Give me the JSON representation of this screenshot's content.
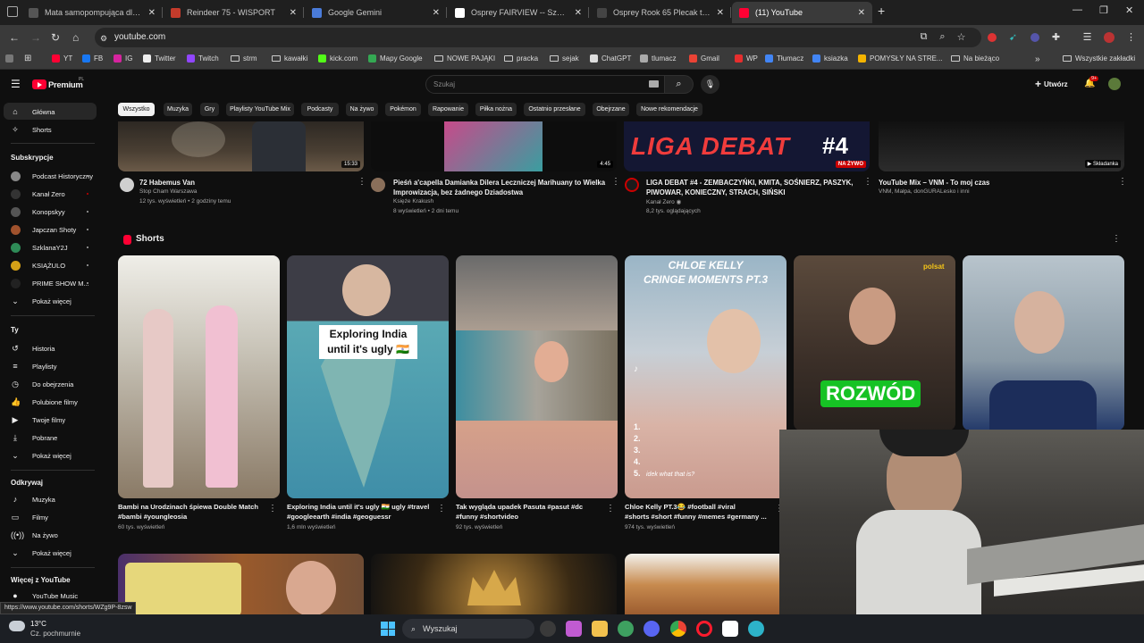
{
  "browser": {
    "tabs": [
      {
        "label": "Mata samopompująca dla back",
        "favicon_color": "#555555",
        "active": false
      },
      {
        "label": "Reindeer 75 - WISPORT",
        "favicon_color": "#c43b2b",
        "active": false
      },
      {
        "label": "Google Gemini",
        "favicon_color": "#4a7bd9",
        "active": false
      },
      {
        "label": "Osprey FAIRVIEW -- Szukaj w G",
        "favicon_color": "#ffffff",
        "active": false
      },
      {
        "label": "Osprey Rook 65 Plecak trekking",
        "favicon_color": "#444444",
        "active": false
      },
      {
        "label": "(11) YouTube",
        "favicon_color": "#ff0033",
        "active": true
      }
    ],
    "url": "youtube.com",
    "bookmarks": [
      {
        "label": "YT",
        "color": "#ff0033"
      },
      {
        "label": "FB",
        "color": "#1877f2"
      },
      {
        "label": "IG",
        "color": "#d6249f"
      },
      {
        "label": "Twitter",
        "color": "#eeeeee"
      },
      {
        "label": "Twitch",
        "color": "#9146ff"
      },
      {
        "label": "strm",
        "color": ""
      },
      {
        "label": "kawałki",
        "color": ""
      },
      {
        "label": "kick.com",
        "color": "#53fc18"
      },
      {
        "label": "Mapy Google",
        "color": "#34a853"
      },
      {
        "label": "NOWE PAJĄKI",
        "color": ""
      },
      {
        "label": "pracka",
        "color": ""
      },
      {
        "label": "sejak",
        "color": ""
      },
      {
        "label": "ChatGPT",
        "color": "#dddddd"
      },
      {
        "label": "tlumacz",
        "color": "#aaaaaa"
      },
      {
        "label": "Gmail",
        "color": "#ea4335"
      },
      {
        "label": "WP",
        "color": "#e62e2e"
      },
      {
        "label": "Tłumacz",
        "color": "#4285f4"
      },
      {
        "label": "ksiazka",
        "color": "#4285f4"
      },
      {
        "label": "POMYSŁY NA STRE...",
        "color": "#f4b400"
      },
      {
        "label": "Na bieżąco",
        "color": ""
      }
    ],
    "all_bookmarks": "Wszystkie zakładki",
    "status_url": "https://www.youtube.com/shorts/WZg9P-8zsw"
  },
  "youtube": {
    "logo_text": "Premium",
    "logo_super": "PL",
    "search_placeholder": "Szukaj",
    "create_label": "Utwórz",
    "notif_count": "9+",
    "chips": [
      "Wszystko",
      "Muzyka",
      "Gry",
      "Playlisty YouTube Mix",
      "Podcasty",
      "Na żywo",
      "Pokémon",
      "Rapowanie",
      "Piłka nożna",
      "Ostatnio przesłane",
      "Obejrzane",
      "Nowe rekomendacje"
    ],
    "sidebar": {
      "main": [
        "Główna",
        "Shorts"
      ],
      "subs_header": "Subskrypcje",
      "subs": [
        {
          "label": "Podcast Historyczny",
          "color": "#888888"
        },
        {
          "label": "Kanał Zero",
          "color": "#333333"
        },
        {
          "label": "Konopskyy",
          "color": "#555555"
        },
        {
          "label": "Japczan Shoty",
          "color": "#a0522d"
        },
        {
          "label": "SzklanaY2J",
          "color": "#2e8b57"
        },
        {
          "label": "KSIĄŻULO",
          "color": "#d4a017"
        },
        {
          "label": "PRIME SHOW M...",
          "color": "#222222"
        }
      ],
      "subs_more": "Pokaż więcej",
      "you_header": "Ty",
      "you": [
        "Historia",
        "Playlisty",
        "Do obejrzenia",
        "Polubione filmy",
        "Twoje filmy",
        "Pobrane"
      ],
      "you_more": "Pokaż więcej",
      "explore_header": "Odkrywaj",
      "explore": [
        "Muzyka",
        "Filmy",
        "Na żywo"
      ],
      "explore_more": "Pokaż więcej",
      "more_header": "Więcej z YouTube",
      "more": [
        "YouTube Music"
      ]
    },
    "videos": [
      {
        "title": "72 Habemus Van",
        "channel": "Stop Cham Warszawa",
        "meta": "12 tys. wyświetleń • 2 godziny temu",
        "duration": "15:33"
      },
      {
        "title_line1": "Pieśń a'capella Damianka Dilera Leczniczej Marihuany to Wielka",
        "title_line2": "Improwizacja, bez żadnego Dziadostwa",
        "channel": "Księże Krakush",
        "meta": "8 wyświetleń • 2 dni temu",
        "duration": "4:45"
      },
      {
        "title_line1": "LIGA DEBAT #4 - ZEMBACZYŃKI, KMITA, SOŚNIERZ, PASZYK,",
        "title_line2": "PIWOWAR, KONIECZNY, STRACH, SIŃSKI",
        "channel": "Kanał Zero",
        "meta": "8,2 tys. oglądających",
        "badge": "NA ŻYWO",
        "thumb_text": "LIGA DEBAT",
        "thumb_num": "#4"
      },
      {
        "title": "YouTube Mix – VNM - To moj czas",
        "channel": "VNM, Małpa, donGURALesko i inni",
        "meta": "",
        "badge": "Składanka"
      }
    ],
    "shorts_header": "Shorts",
    "shorts": [
      {
        "title_line1": "Bambi na Urodzinach śpiewa Double Match",
        "title_line2": "#bambi #youngleosia",
        "views": "60 tys. wyświetleń",
        "overlay": ""
      },
      {
        "title_line1": "Exploring India until it's ugly 🇮🇳 ugly #travel",
        "title_line2": "#googleearth #india #geoguessr",
        "views": "1,6 mln wyświetleń",
        "overlay": "Exploring India\nuntil it's ugly 🇮🇳"
      },
      {
        "title_line1": "Tak wygląda upadek Pasuta #pasut #dc",
        "title_line2": "#funny #shortvideo",
        "views": "92 tys. wyświetleń",
        "overlay": ""
      },
      {
        "title_line1": "Chloe Kelly PT.3😂 #football #viral",
        "title_line2": "#shorts #short #funny #memes #germany ...",
        "views": "974 tys. wyświetleń",
        "overlay": "CHLOE KELLY\nCRINGE MOMENTS PT.3",
        "caption": "idek what that is?"
      },
      {
        "title_line1": "",
        "title_line2": "",
        "views": "",
        "overlay": "ROZWÓD",
        "brand": "polsat"
      },
      {
        "title_line1": "",
        "title_line2": "",
        "views": "",
        "overlay": ""
      }
    ]
  },
  "taskbar": {
    "weather_temp": "13°C",
    "weather_desc": "Cz. pochmurnie",
    "search_placeholder": "Wyszukaj"
  }
}
